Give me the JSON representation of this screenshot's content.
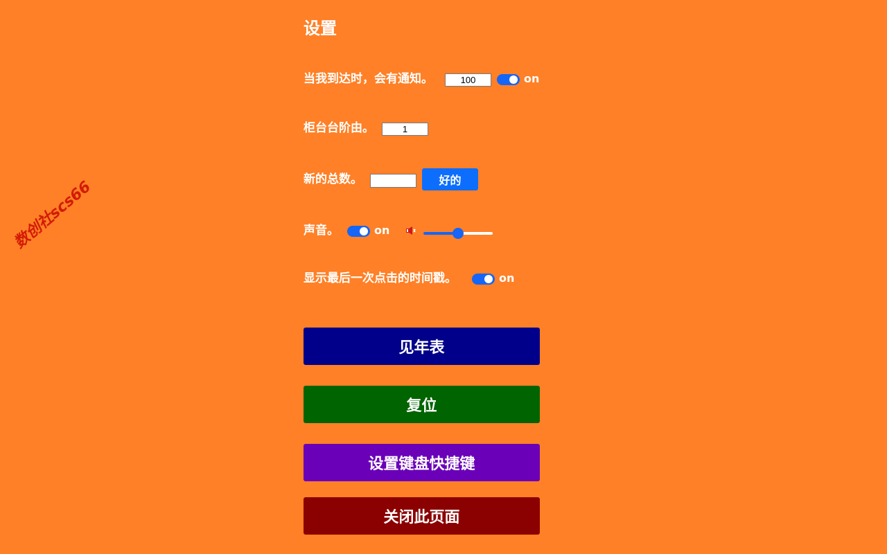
{
  "page": {
    "title": "设置"
  },
  "notify": {
    "label": "当我到达时，会有通知。",
    "value": "100",
    "toggle_text": "on"
  },
  "counter": {
    "label": "柜台台阶由。",
    "value": "1"
  },
  "total": {
    "label": "新的总数。",
    "value": "",
    "ok_label": "好的"
  },
  "sound": {
    "label": "声音。",
    "toggle_text": "on",
    "volume_percent": 50
  },
  "timestamp": {
    "label": "显示最后一次点击的时间戳。",
    "toggle_text": "on"
  },
  "buttons": {
    "year_table": "见年表",
    "reset": "复位",
    "shortcuts": "设置键盘快捷键",
    "close": "关闭此页面"
  },
  "watermark": "数创社scs66",
  "colors": {
    "background": "#ff8026",
    "toggle_on": "#1565f6",
    "ok_button": "#0d6efd",
    "year_table_button": "#00008b",
    "reset_button": "#006400",
    "shortcuts_button": "#6a00b8",
    "close_button": "#8b0000"
  }
}
